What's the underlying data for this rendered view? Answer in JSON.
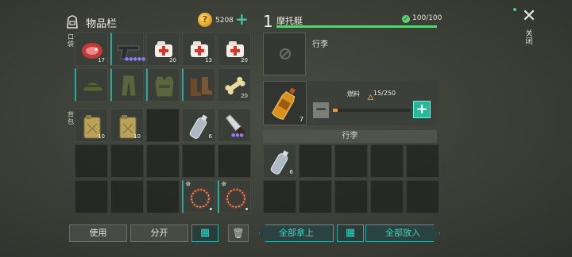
{
  "inventory": {
    "title": "物品栏",
    "coins": "5208",
    "coin_symbol": "?",
    "pocket_label": "口袋",
    "backpack_label": "背包",
    "pocket_slots": [
      {
        "icon": "raw-meat-icon",
        "qty": "17"
      },
      {
        "icon": "pistol-icon",
        "qty": "",
        "dots": "●●●●●"
      },
      {
        "icon": "medkit-icon",
        "qty": "20"
      },
      {
        "icon": "medkit-icon",
        "qty": "13"
      },
      {
        "icon": "medkit-icon",
        "qty": "20"
      },
      {
        "icon": "helmet-icon",
        "qty": ""
      },
      {
        "icon": "pants-icon",
        "qty": ""
      },
      {
        "icon": "vest-icon",
        "qty": ""
      },
      {
        "icon": "boots-icon",
        "qty": ""
      },
      {
        "icon": "bone-icon",
        "qty": "20"
      }
    ],
    "backpack_slots": [
      {
        "icon": "jerrycan-icon",
        "qty": "10"
      },
      {
        "icon": "jerrycan-icon",
        "qty": "10"
      },
      {
        "icon": "",
        "qty": ""
      },
      {
        "icon": "water-bottle-icon",
        "qty": "6"
      },
      {
        "icon": "machete-icon",
        "qty": "",
        "dots": "●●●"
      },
      {
        "icon": "",
        "qty": ""
      },
      {
        "icon": "",
        "qty": ""
      },
      {
        "icon": "",
        "qty": ""
      },
      {
        "icon": "",
        "qty": ""
      },
      {
        "icon": "",
        "qty": ""
      },
      {
        "icon": "",
        "qty": ""
      },
      {
        "icon": "",
        "qty": ""
      },
      {
        "icon": "",
        "qty": ""
      },
      {
        "icon": "spike-trap-icon",
        "qty": ""
      },
      {
        "icon": "spike-trap-icon",
        "qty": ""
      }
    ],
    "use_button": "使用",
    "split_button": "分开"
  },
  "vehicle": {
    "slot_number": "1",
    "name": "摩托艇",
    "durability": "100/100",
    "durability_fraction": 1.0,
    "engine_label": "行李",
    "fuel_item_qty": "7",
    "fuel_label": "燃料",
    "fuel_value": "15/250",
    "fuel_fraction": 0.06,
    "trunk_label": "行李",
    "trunk_slots": [
      {
        "icon": "water-bottle-icon",
        "qty": "6"
      },
      {
        "icon": "",
        "qty": ""
      },
      {
        "icon": "",
        "qty": ""
      },
      {
        "icon": "",
        "qty": ""
      },
      {
        "icon": "",
        "qty": ""
      },
      {
        "icon": "",
        "qty": ""
      },
      {
        "icon": "",
        "qty": ""
      },
      {
        "icon": "",
        "qty": ""
      },
      {
        "icon": "",
        "qty": ""
      },
      {
        "icon": "",
        "qty": ""
      }
    ],
    "take_all_button": "全部拿上",
    "put_all_button": "全部放入"
  },
  "close_label": "关闭",
  "colors": {
    "accent": "#2aa9a0",
    "accent_text": "#3fd3c1",
    "durability": "#5fd078",
    "fuel": "#f29a26",
    "rarity_dots": "#8b7cf5"
  }
}
